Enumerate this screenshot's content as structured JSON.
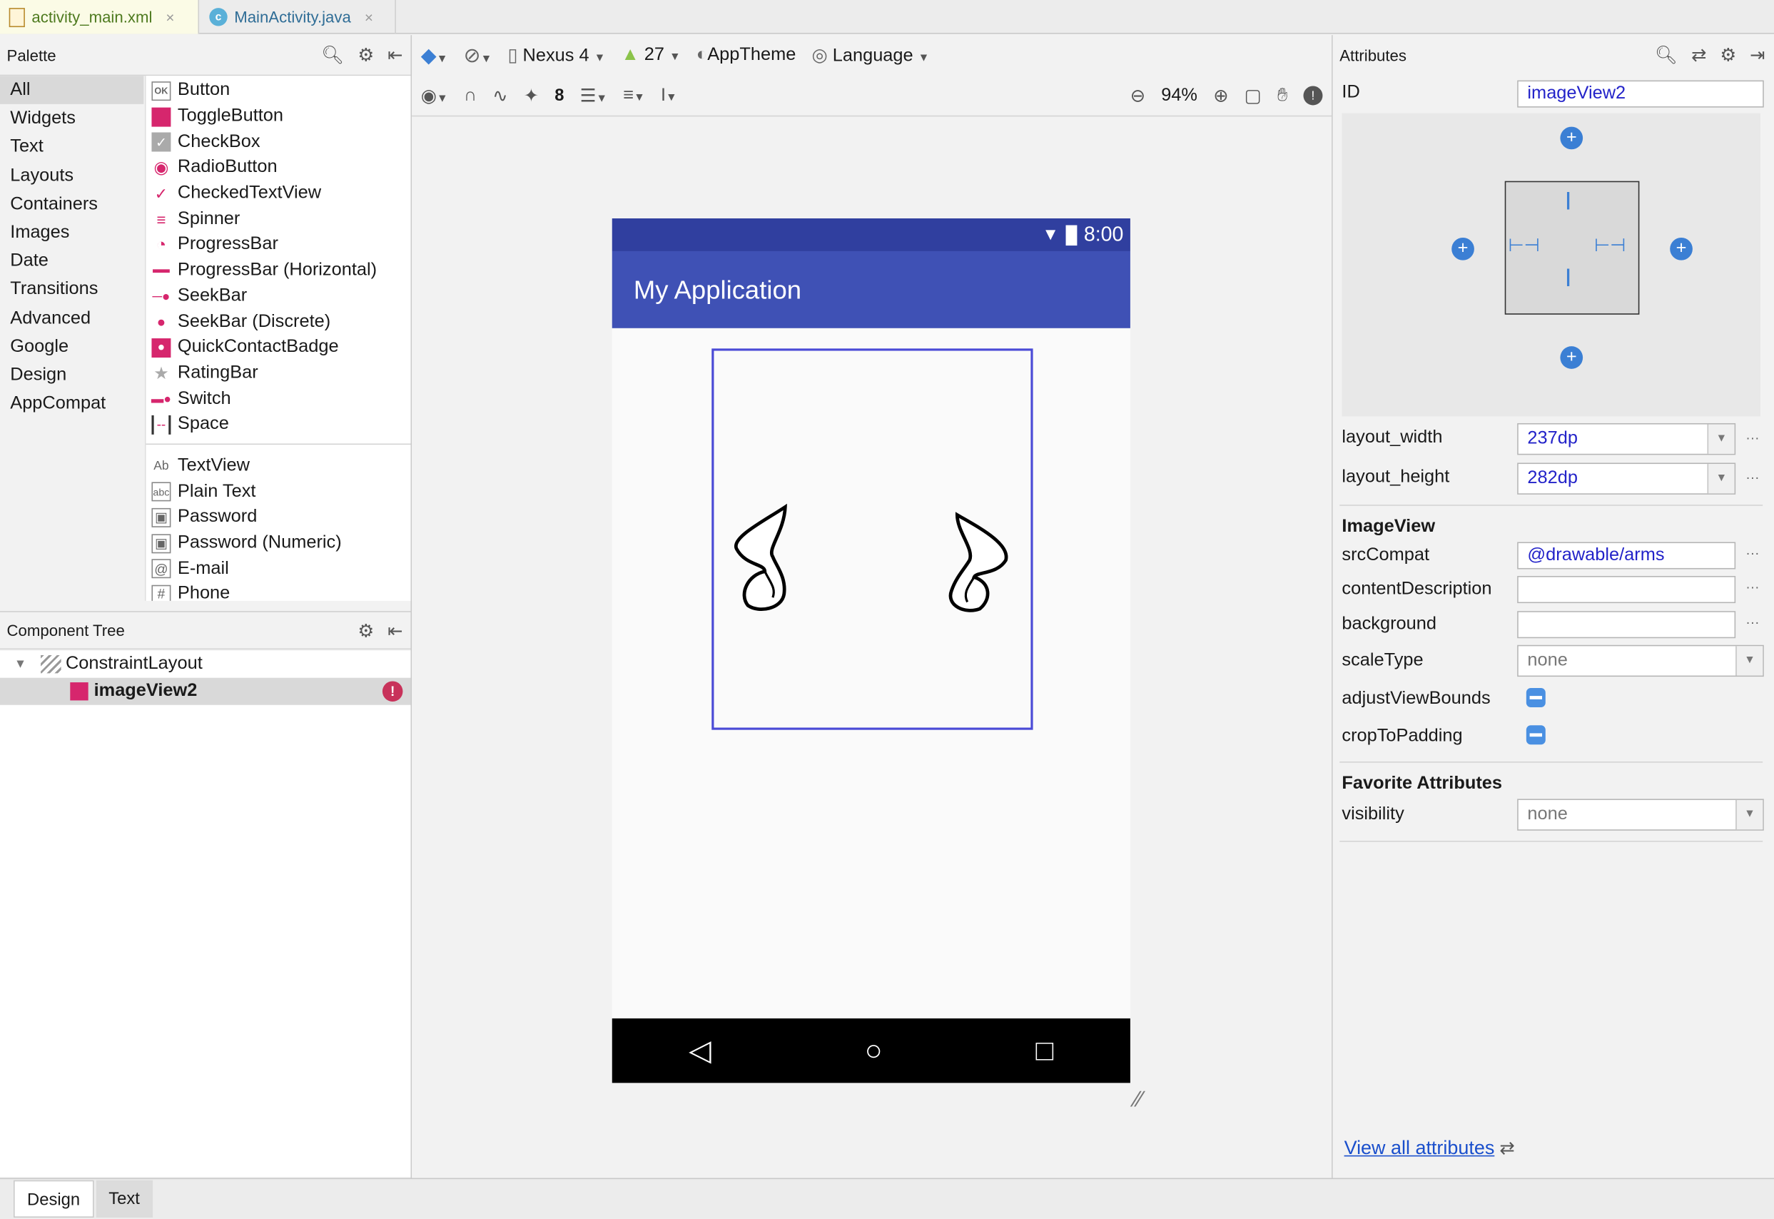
{
  "tabs": [
    {
      "label": "activity_main.xml",
      "close": "×"
    },
    {
      "label": "MainActivity.java",
      "close": "×",
      "icon_letter": "c"
    }
  ],
  "palette": {
    "title": "Palette",
    "categories": [
      "All",
      "Widgets",
      "Text",
      "Layouts",
      "Containers",
      "Images",
      "Date",
      "Transitions",
      "Advanced",
      "Google",
      "Design",
      "AppCompat"
    ],
    "items_group1": [
      "Button",
      "ToggleButton",
      "CheckBox",
      "RadioButton",
      "CheckedTextView",
      "Spinner",
      "ProgressBar",
      "ProgressBar (Horizontal)",
      "SeekBar",
      "SeekBar (Discrete)",
      "QuickContactBadge",
      "RatingBar",
      "Switch",
      "Space"
    ],
    "items_group2": [
      "TextView",
      "Plain Text",
      "Password",
      "Password (Numeric)",
      "E-mail",
      "Phone"
    ],
    "icon_texts": {
      "button": "OK",
      "textview": "Ab",
      "plaintext": "abc",
      "email": "@",
      "phone": "#"
    }
  },
  "component_tree": {
    "title": "Component Tree",
    "root": "ConstraintLayout",
    "child": "imageView2"
  },
  "toolbar": {
    "device": "Nexus 4",
    "api": "27",
    "theme": "AppTheme",
    "language": "Language",
    "margin": "8",
    "zoom": "94%"
  },
  "phone": {
    "time": "8:00",
    "app_title": "My Application"
  },
  "attributes": {
    "title": "Attributes",
    "id_label": "ID",
    "id_value": "imageView2",
    "layout_width_label": "layout_width",
    "layout_width_value": "237dp",
    "layout_height_label": "layout_height",
    "layout_height_value": "282dp",
    "section_imageview": "ImageView",
    "srccompat_label": "srcCompat",
    "srccompat_value": "@drawable/arms",
    "contentdesc_label": "contentDescription",
    "background_label": "background",
    "scaletype_label": "scaleType",
    "scaletype_value": "none",
    "adjust_label": "adjustViewBounds",
    "crop_label": "cropToPadding",
    "section_favorite": "Favorite Attributes",
    "visibility_label": "visibility",
    "visibility_value": "none",
    "more": "···",
    "view_all": "View all attributes"
  },
  "bottom_tabs": [
    "Design",
    "Text"
  ],
  "colors": {
    "app_bar": "#3f51b5",
    "status_bar": "#303f9f",
    "accent": "#d6266d",
    "link": "#1a4fcc"
  }
}
